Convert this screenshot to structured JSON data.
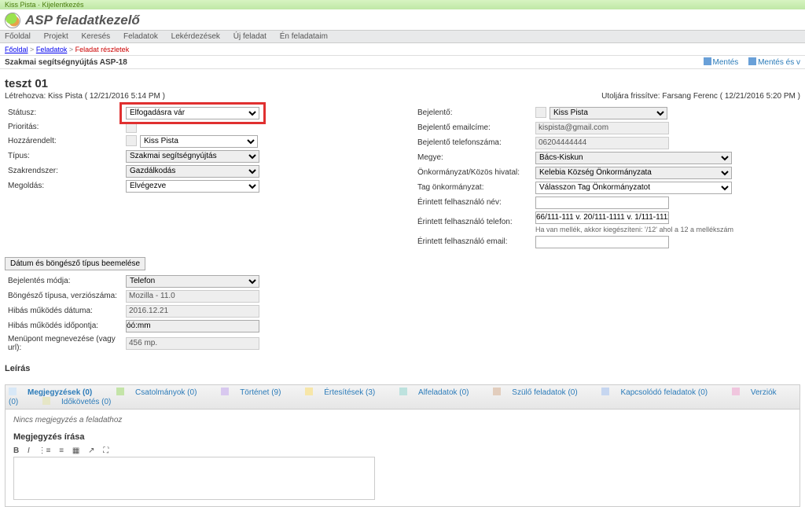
{
  "top": {
    "user": "Kiss Pista",
    "logout": "Kijelentkezés"
  },
  "brand": {
    "title": "ASP feladatkezelő"
  },
  "menu": [
    "Főoldal",
    "Projekt",
    "Keresés",
    "Feladatok",
    "Lekérdezések",
    "Új feladat",
    "Én feladataim"
  ],
  "breadcrumb": {
    "home": "Főoldal",
    "mid": "Feladatok",
    "cur": "Feladat részletek",
    "sep": ">"
  },
  "titlebar": {
    "left": "Szakmai segítségnyújtás ASP-18",
    "save": "Mentés",
    "saveAndClose": "Mentés és v"
  },
  "task": {
    "subtitle": "teszt 01",
    "created": "Létrehozva: Kiss Pista ( 12/21/2016 5:14 PM )",
    "updated": "Utoljára frissítve: Farsang Ferenc ( 12/21/2016 5:20 PM )"
  },
  "left": {
    "status_label": "Státusz:",
    "status_value": "Elfogadásra vár",
    "priority_label": "Prioritás:",
    "priority_value": "",
    "assignee_label": "Hozzárendelt:",
    "assignee_value": "Kiss Pista",
    "type_label": "Típus:",
    "type_value": "Szakmai segítségnyújtás",
    "dept_label": "Szakrendszer:",
    "dept_value": "Gazdálkodás",
    "sol_label": "Megoldás:",
    "sol_value": "Elvégezve"
  },
  "right": {
    "reporter_label": "Bejelentő:",
    "reporter_value": "Kiss Pista",
    "email_label": "Bejelentő emailcíme:",
    "email_value": "kispista@gmail.com",
    "phone_label": "Bejelentő telefonszáma:",
    "phone_value": "06204444444",
    "county_label": "Megye:",
    "county_value": "Bács-Kiskun",
    "office_label": "Önkormányzat/Közös hivatal:",
    "office_value": "Kelebia Község Önkormányzata",
    "tag_label": "Tag önkormányzat:",
    "tag_value": "Válasszon Tag Önkormányzatot",
    "affuser_label": "Érintett felhasználó név:",
    "affuser_value": "",
    "affphone_label": "Érintett felhasználó telefon:",
    "affphone_value": "66/111-111 v. 20/111-1111 v. 1/111-1111",
    "affphone_help": "Ha van mellék, akkor kiegészíteni: '/12' ahol a 12 a mellékszám",
    "affemail_label": "Érintett felhasználó email:",
    "affemail_value": ""
  },
  "extra": {
    "button": "Dátum és böngésző típus beemelése",
    "mode_label": "Bejelentés módja:",
    "mode_value": "Telefon",
    "browser_label": "Böngésző típusa, verziószáma:",
    "browser_value": "Mozilla - 11.0",
    "errdate_label": "Hibás működés dátuma:",
    "errdate_value": "2016.12.21",
    "errtime_label": "Hibás működés időpontja:",
    "errtime_value": "óó:mm",
    "menupt_label": "Menüpont megnevezése (vagy url):",
    "menupt_value": "456 mp."
  },
  "desc_label": "Leírás",
  "tabs": {
    "comments": "Megjegyzések (0)",
    "attach": "Csatolmányok (0)",
    "history": "Történet (9)",
    "notif": "Értesítések (3)",
    "sub": "Alfeladatok (0)",
    "parent": "Szülő feladatok (0)",
    "related": "Kapcsolódó feladatok (0)",
    "versions": "Verziók (0)",
    "time": "Időkövetés (0)"
  },
  "comments": {
    "empty": "Nincs megjegyzés a feladathoz",
    "write": "Megjegyzés írása"
  },
  "editor": {
    "b": "B",
    "i": "I"
  }
}
